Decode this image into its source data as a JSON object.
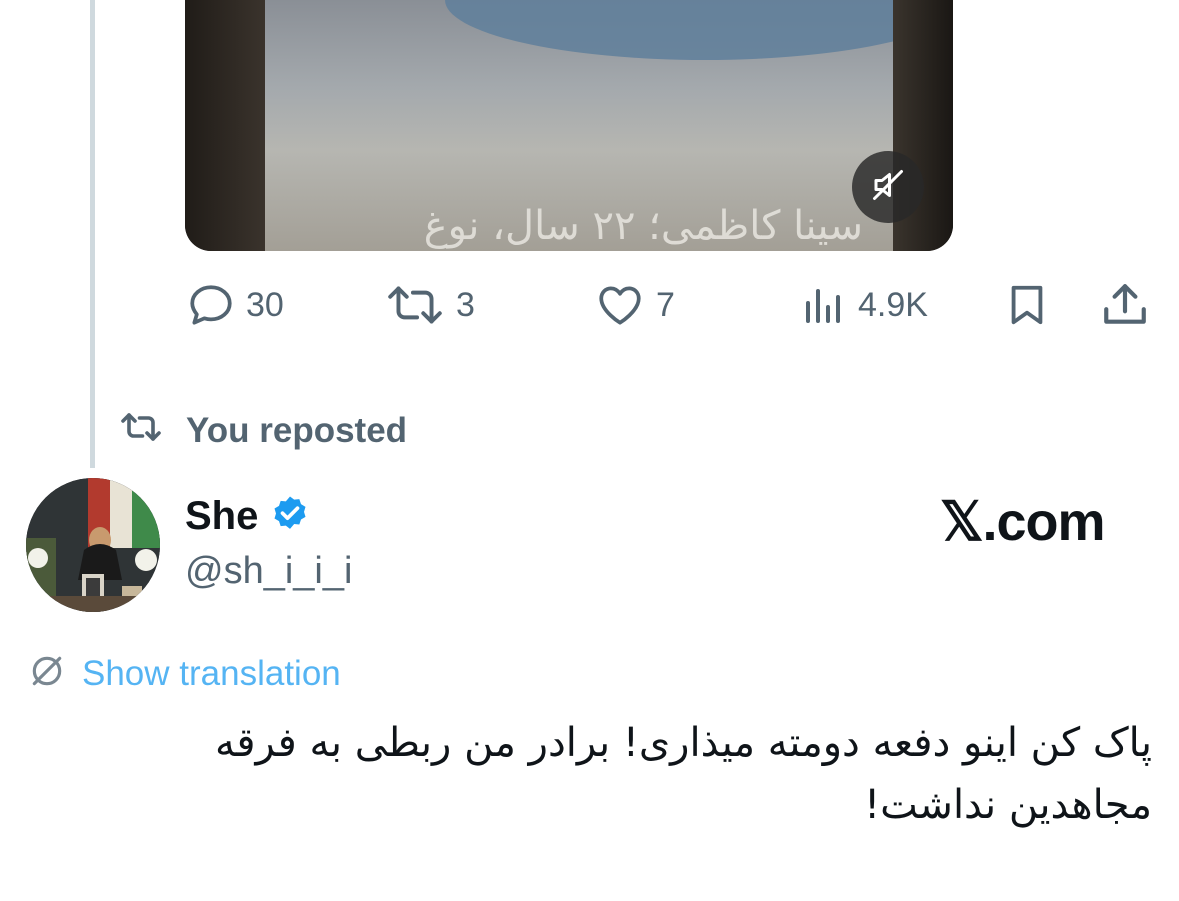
{
  "media": {
    "caption": "سینا کاظمی؛ ۲۲ سال، نوغ",
    "mute_icon": "speaker-muted-icon"
  },
  "actions": {
    "replies": {
      "icon": "reply-icon",
      "count": "30"
    },
    "reposts": {
      "icon": "repost-icon",
      "count": "3"
    },
    "likes": {
      "icon": "heart-icon",
      "count": "7"
    },
    "views": {
      "icon": "views-icon",
      "count": "4.9K"
    },
    "bookmark": {
      "icon": "bookmark-icon"
    },
    "share": {
      "icon": "share-icon"
    }
  },
  "repost_label": "You reposted",
  "author": {
    "name": "She",
    "verified": true,
    "handle": "@sh_i_i_i"
  },
  "brand": "𝕏.com",
  "translation_link": "Show translation",
  "tweet": {
    "lines": [
      "پاک کن اینو دفعه دومته میذاری! برادر من ربطی به فرقه",
      "مجاهدین نداشت!"
    ]
  },
  "colors": {
    "text_primary": "#0f1419",
    "text_secondary": "#536471",
    "link": "#1d9bf0",
    "verified": "#1d9bf0",
    "thread_line": "#cfd9de"
  }
}
